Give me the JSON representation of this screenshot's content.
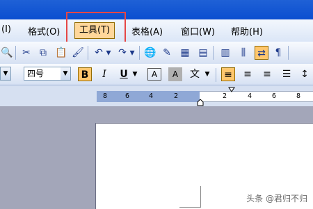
{
  "menu": {
    "items": [
      {
        "label": "(I)"
      },
      {
        "label": "格式(O)"
      },
      {
        "label": "工具(T)"
      },
      {
        "label": "表格(A)"
      },
      {
        "label": "窗口(W)"
      },
      {
        "label": "帮助(H)"
      }
    ]
  },
  "format_toolbar": {
    "font_size_value": "四号"
  },
  "ruler": {
    "labels": [
      "8",
      "6",
      "4",
      "2",
      "2",
      "4",
      "6",
      "8"
    ]
  },
  "watermark": "头条 @君归不归",
  "colors": {
    "highlight": "#ffd79a",
    "annotation": "#e54646"
  }
}
